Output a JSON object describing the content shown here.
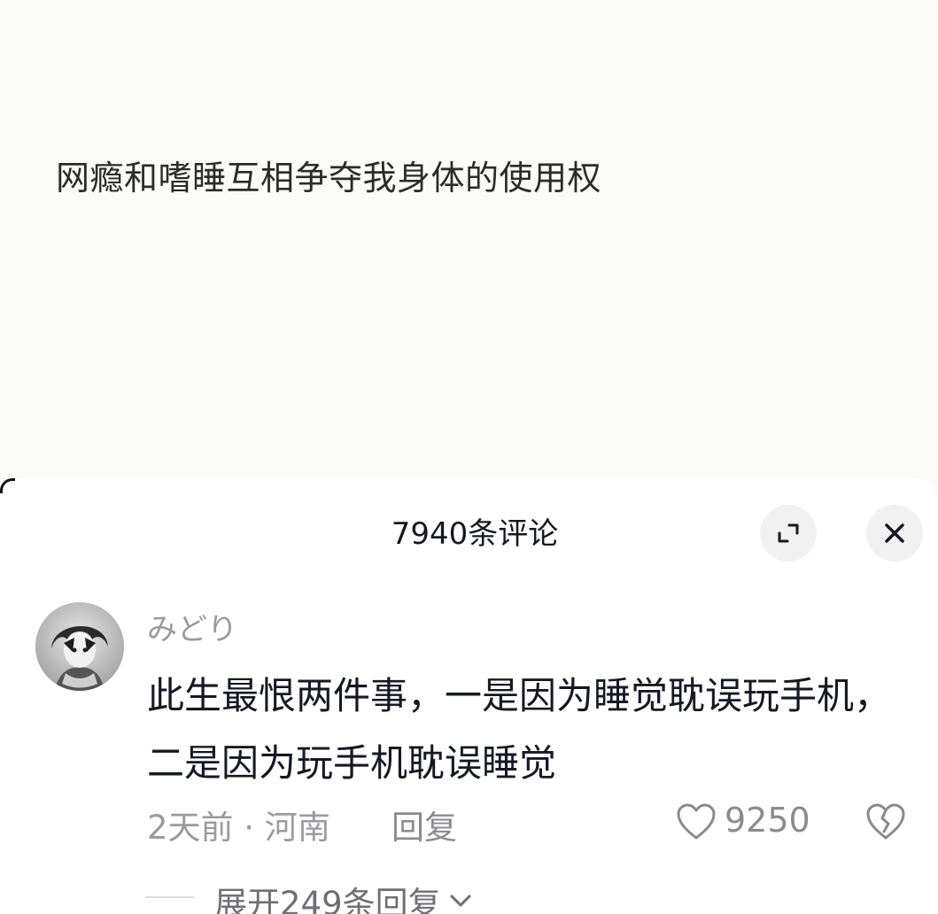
{
  "post": {
    "text": "网瘾和嗜睡互相争夺我身体的使用权"
  },
  "comments_panel": {
    "title": "7940条评论",
    "expand_icon": "expand-icon",
    "close_icon": "close-icon"
  },
  "comment": {
    "username": "みどり",
    "text": "此生最恨两件事，一是因为睡觉耽误玩手机，二是因为玩手机耽误睡觉",
    "time_location": "2天前 · 河南",
    "reply_label": "回复",
    "likes": "9250",
    "like_icon": "heart-outline-icon",
    "dislike_icon": "broken-heart-icon"
  },
  "expand_replies": {
    "label": "展开249条回复",
    "icon": "chevron-down-icon"
  }
}
